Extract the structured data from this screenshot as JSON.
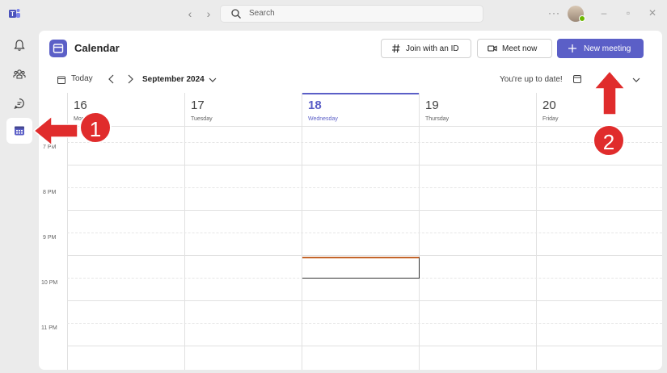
{
  "titlebar": {
    "search_placeholder": "Search",
    "more": "···"
  },
  "header": {
    "title": "Calendar",
    "join_label": "Join with an ID",
    "meet_label": "Meet now",
    "new_label": "New meeting"
  },
  "toolbar": {
    "today": "Today",
    "month": "September 2024",
    "status": "You're up to date!"
  },
  "days": [
    {
      "num": "16",
      "name": "Monday"
    },
    {
      "num": "17",
      "name": "Tuesday"
    },
    {
      "num": "18",
      "name": "Wednesday"
    },
    {
      "num": "19",
      "name": "Thursday"
    },
    {
      "num": "20",
      "name": "Friday"
    }
  ],
  "times": [
    "7 PM",
    "8 PM",
    "9 PM",
    "10 PM",
    "11 PM"
  ],
  "annotations": {
    "one": "1",
    "two": "2"
  },
  "colors": {
    "accent": "#5b5fc7",
    "annotation": "#e02c2c"
  }
}
